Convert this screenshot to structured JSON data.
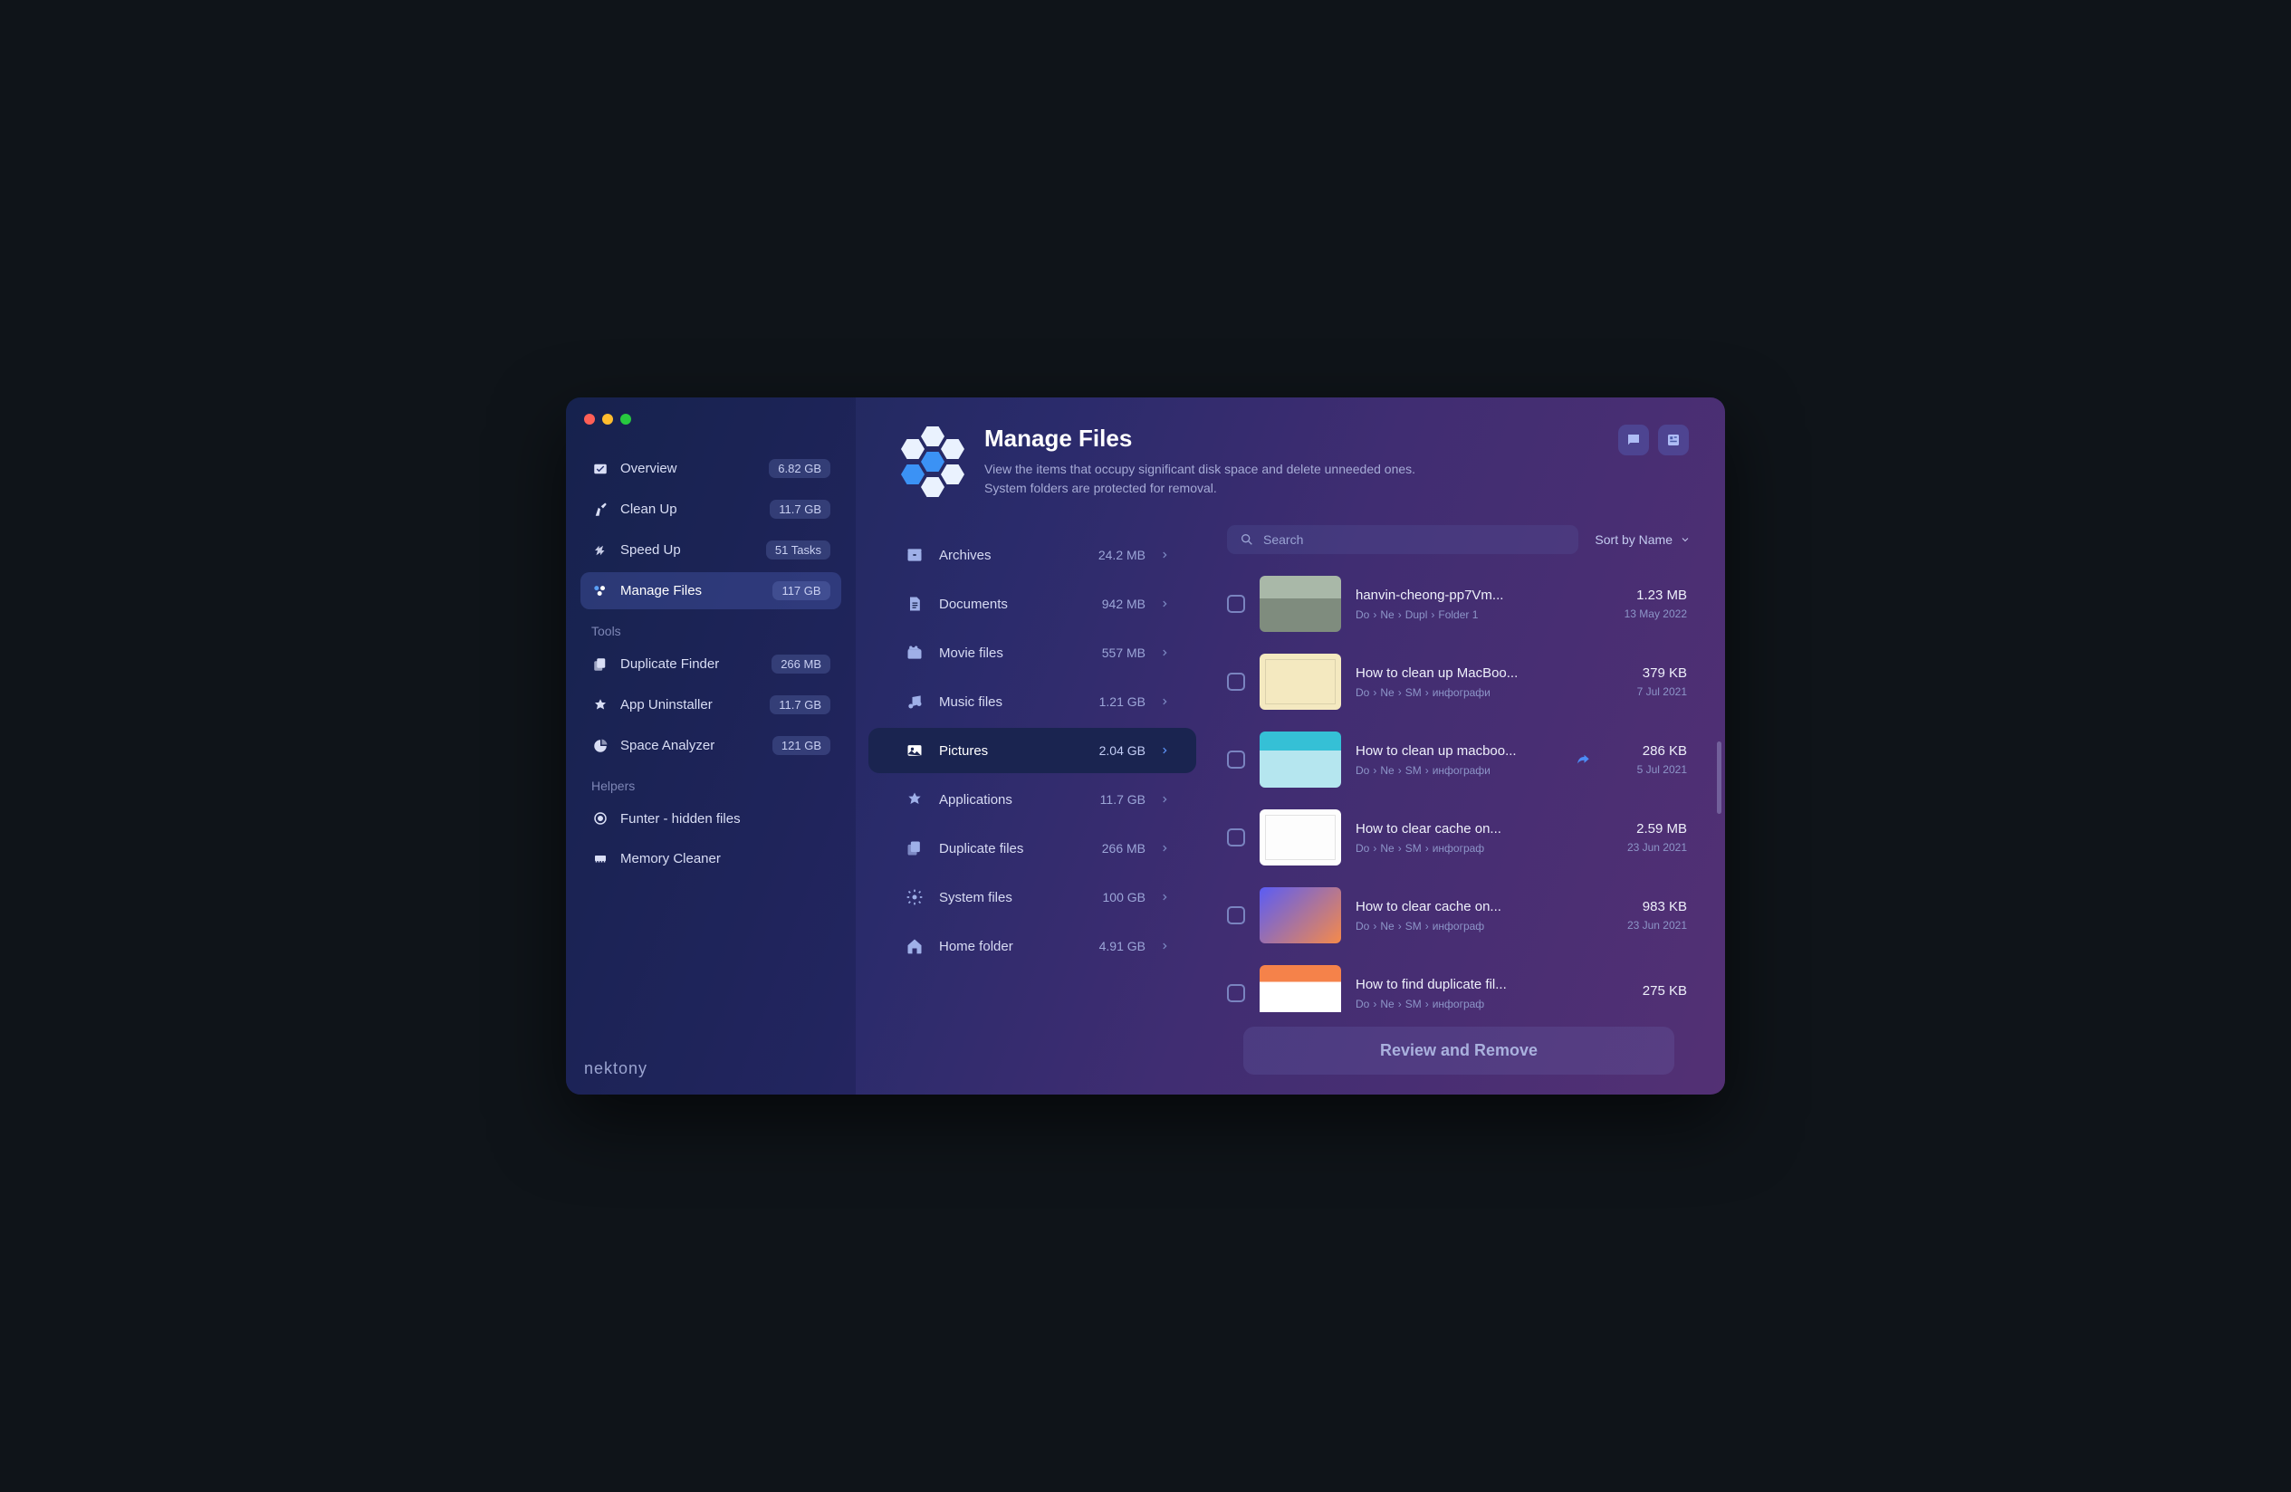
{
  "sidebar": {
    "main": [
      {
        "icon": "overview",
        "label": "Overview",
        "badge": "6.82 GB",
        "active": false
      },
      {
        "icon": "cleanup",
        "label": "Clean Up",
        "badge": "11.7 GB",
        "active": false
      },
      {
        "icon": "speedup",
        "label": "Speed Up",
        "badge": "51 Tasks",
        "active": false
      },
      {
        "icon": "manage",
        "label": "Manage Files",
        "badge": "117 GB",
        "active": true
      }
    ],
    "tools_header": "Tools",
    "tools": [
      {
        "icon": "duplicate",
        "label": "Duplicate Finder",
        "badge": "266 MB"
      },
      {
        "icon": "uninstall",
        "label": "App Uninstaller",
        "badge": "11.7 GB"
      },
      {
        "icon": "space",
        "label": "Space Analyzer",
        "badge": "121 GB"
      }
    ],
    "helpers_header": "Helpers",
    "helpers": [
      {
        "icon": "funter",
        "label": "Funter - hidden files",
        "badge": ""
      },
      {
        "icon": "memory",
        "label": "Memory Cleaner",
        "badge": ""
      }
    ],
    "brand": "nektony"
  },
  "header": {
    "title": "Manage Files",
    "desc1": "View the items that occupy significant disk space and delete unneeded ones.",
    "desc2": "System folders are protected for removal."
  },
  "categories": [
    {
      "icon": "archive",
      "label": "Archives",
      "size": "24.2 MB",
      "active": false
    },
    {
      "icon": "doc",
      "label": "Documents",
      "size": "942 MB",
      "active": false
    },
    {
      "icon": "movie",
      "label": "Movie files",
      "size": "557 MB",
      "active": false
    },
    {
      "icon": "music",
      "label": "Music files",
      "size": "1.21 GB",
      "active": false
    },
    {
      "icon": "picture",
      "label": "Pictures",
      "size": "2.04 GB",
      "active": true
    },
    {
      "icon": "apps",
      "label": "Applications",
      "size": "11.7 GB",
      "active": false
    },
    {
      "icon": "dup",
      "label": "Duplicate files",
      "size": "266 MB",
      "active": false
    },
    {
      "icon": "system",
      "label": "System files",
      "size": "100 GB",
      "active": false
    },
    {
      "icon": "home",
      "label": "Home folder",
      "size": "4.91 GB",
      "active": false
    }
  ],
  "search": {
    "placeholder": "Search"
  },
  "sort_label": "Sort by Name",
  "files": [
    {
      "name": "hanvin-cheong-pp7Vm...",
      "path": [
        "Do",
        "Ne",
        "Dupl",
        "Folder 1"
      ],
      "size": "1.23 MB",
      "date": "13 May 2022",
      "thumb": "th1",
      "share": false
    },
    {
      "name": "How to clean up MacBoo...",
      "path": [
        "Do",
        "Ne",
        "SM",
        "инфографи"
      ],
      "size": "379 KB",
      "date": "7 Jul 2021",
      "thumb": "th2",
      "share": false
    },
    {
      "name": "How to clean up macboo...",
      "path": [
        "Do",
        "Ne",
        "SM",
        "инфографи"
      ],
      "size": "286 KB",
      "date": "5 Jul 2021",
      "thumb": "th3",
      "share": true
    },
    {
      "name": "How to clear cache on...",
      "path": [
        "Do",
        "Ne",
        "SM",
        "инфограф"
      ],
      "size": "2.59 MB",
      "date": "23 Jun 2021",
      "thumb": "th4",
      "share": false
    },
    {
      "name": "How to clear cache on...",
      "path": [
        "Do",
        "Ne",
        "SM",
        "инфограф"
      ],
      "size": "983 KB",
      "date": "23 Jun 2021",
      "thumb": "th5",
      "share": false
    },
    {
      "name": "How to find duplicate fil...",
      "path": [
        "Do",
        "Ne",
        "SM",
        "инфограф"
      ],
      "size": "275 KB",
      "date": "",
      "thumb": "th6",
      "share": false
    }
  ],
  "review_btn": "Review and Remove"
}
